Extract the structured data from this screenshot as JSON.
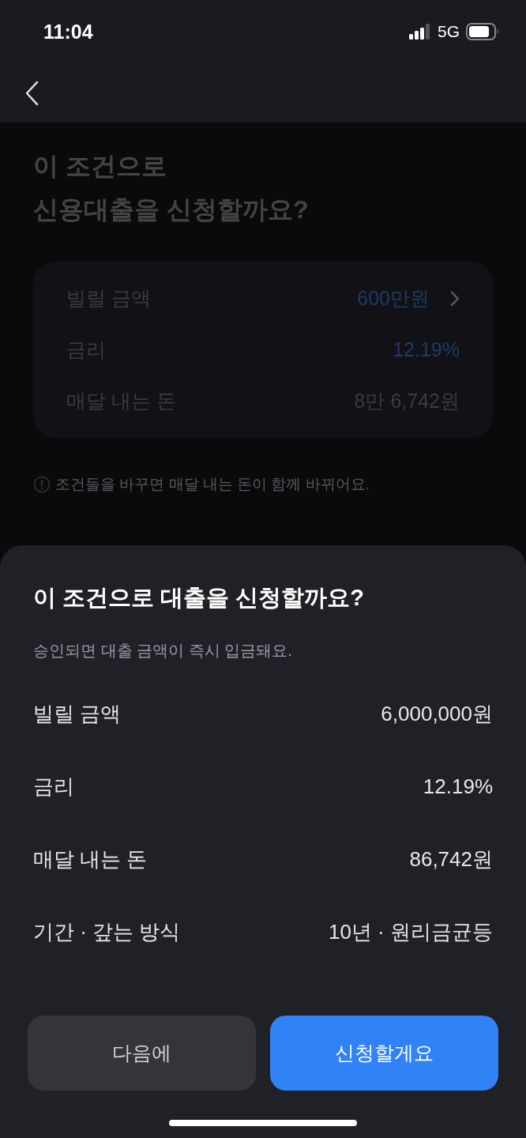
{
  "status_bar": {
    "time": "11:04",
    "network": "5G"
  },
  "background": {
    "title_lines": [
      "이 조건으로",
      "신용대출을 신청할까요?"
    ],
    "summary": [
      {
        "label": "빌릴 금액",
        "value": "600만원",
        "highlight": true,
        "link": true
      },
      {
        "label": "금리",
        "value": "12.19%",
        "highlight": true,
        "link": false
      },
      {
        "label": "매달 내는 돈",
        "value": "8만 6,742원",
        "highlight": false,
        "link": false
      }
    ],
    "notice": "조건들을 바꾸면 매달 내는 돈이 함께 바뀌어요."
  },
  "sheet": {
    "title": "이 조건으로 대출을 신청할까요?",
    "subtitle": "승인되면 대출 금액이 즉시 입금돼요.",
    "rows": [
      {
        "label": "빌릴 금액",
        "value": "6,000,000원"
      },
      {
        "label": "금리",
        "value": "12.19%"
      },
      {
        "label": "매달 내는 돈",
        "value": "86,742원"
      },
      {
        "label": "기간 · 갚는 방식",
        "value": "10년 · 원리금균등"
      }
    ],
    "buttons": [
      {
        "label": "다음에",
        "kind": "secondary"
      },
      {
        "label": "신청할게요",
        "kind": "primary"
      }
    ]
  }
}
